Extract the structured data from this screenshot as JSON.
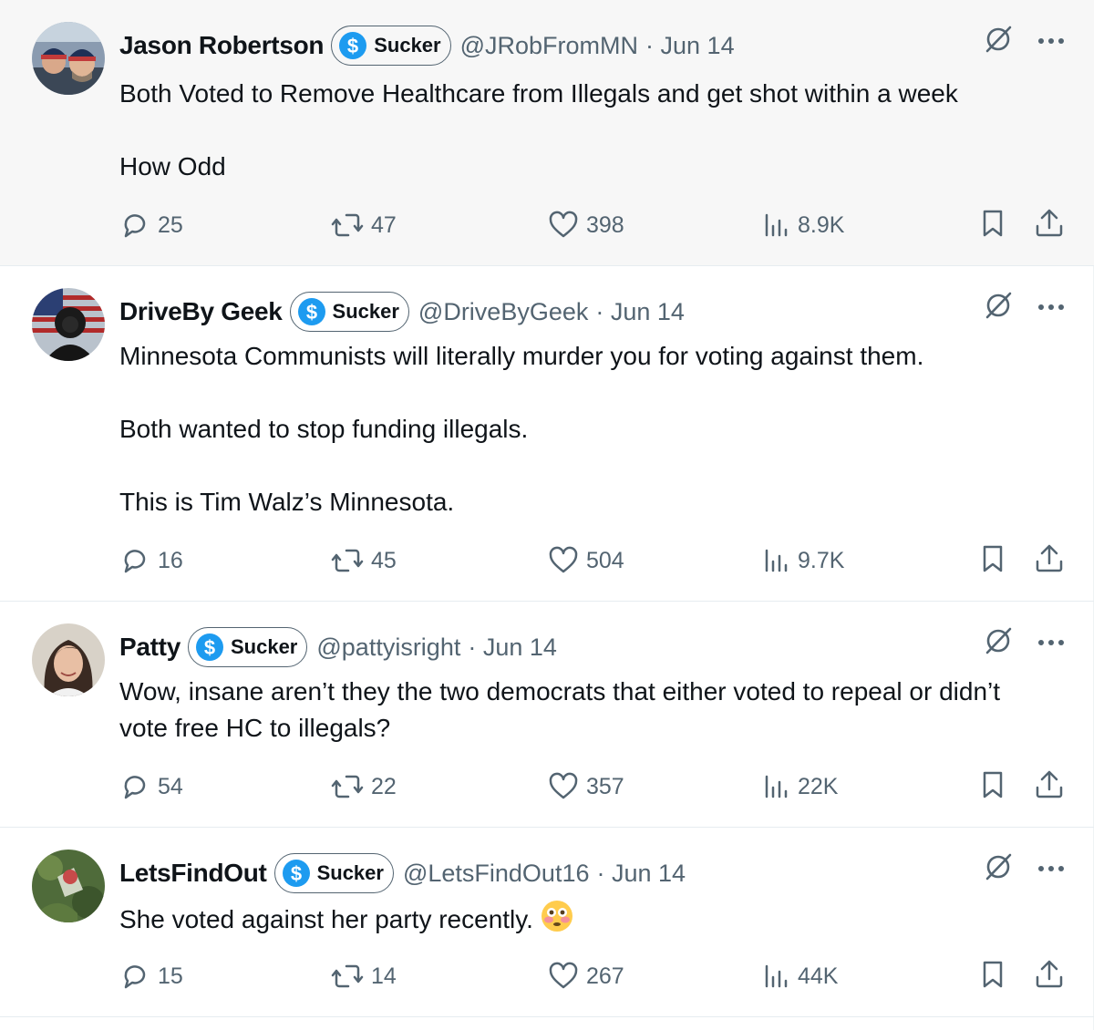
{
  "tweets": [
    {
      "name": "Jason Robertson",
      "badge": "Sucker",
      "handle": "@JRobFromMN",
      "date": "· Jun 14",
      "paragraphs": [
        "Both Voted to Remove Healthcare from Illegals and get shot within a week",
        "How Odd"
      ],
      "replies": "25",
      "reposts": "47",
      "likes": "398",
      "views": "8.9K"
    },
    {
      "name": "DriveBy Geek",
      "badge": "Sucker",
      "handle": "@DriveByGeek",
      "date": "· Jun 14",
      "paragraphs": [
        "Minnesota Communists will literally murder you for voting against them.",
        "Both wanted to stop funding illegals.",
        "This is Tim Walz’s Minnesota."
      ],
      "replies": "16",
      "reposts": "45",
      "likes": "504",
      "views": "9.7K"
    },
    {
      "name": "Patty",
      "badge": "Sucker",
      "handle": "@pattyisright",
      "date": "· Jun 14",
      "paragraphs": [
        "Wow, insane aren’t they the two democrats that either voted to repeal or didn’t vote free HC to illegals?"
      ],
      "replies": "54",
      "reposts": "22",
      "likes": "357",
      "views": "22K"
    },
    {
      "name": "LetsFindOut",
      "badge": "Sucker",
      "handle": "@LetsFindOut16",
      "date": "· Jun 14",
      "paragraphs": [
        "She voted against her party recently."
      ],
      "emoji": "flushed-face",
      "replies": "15",
      "reposts": "14",
      "likes": "267",
      "views": "44K"
    }
  ],
  "icons": {
    "badge": "dollar-coin-icon",
    "grok": "grok-slash-icon",
    "more": "more-dots-icon",
    "reply": "reply-icon",
    "repost": "repost-icon",
    "like": "heart-icon",
    "views": "views-icon",
    "bookmark": "bookmark-icon",
    "share": "share-icon"
  },
  "colors": {
    "badge_blue": "#1d9bf0",
    "muted": "#536471",
    "highlight_bg": "#f7f7f7"
  }
}
